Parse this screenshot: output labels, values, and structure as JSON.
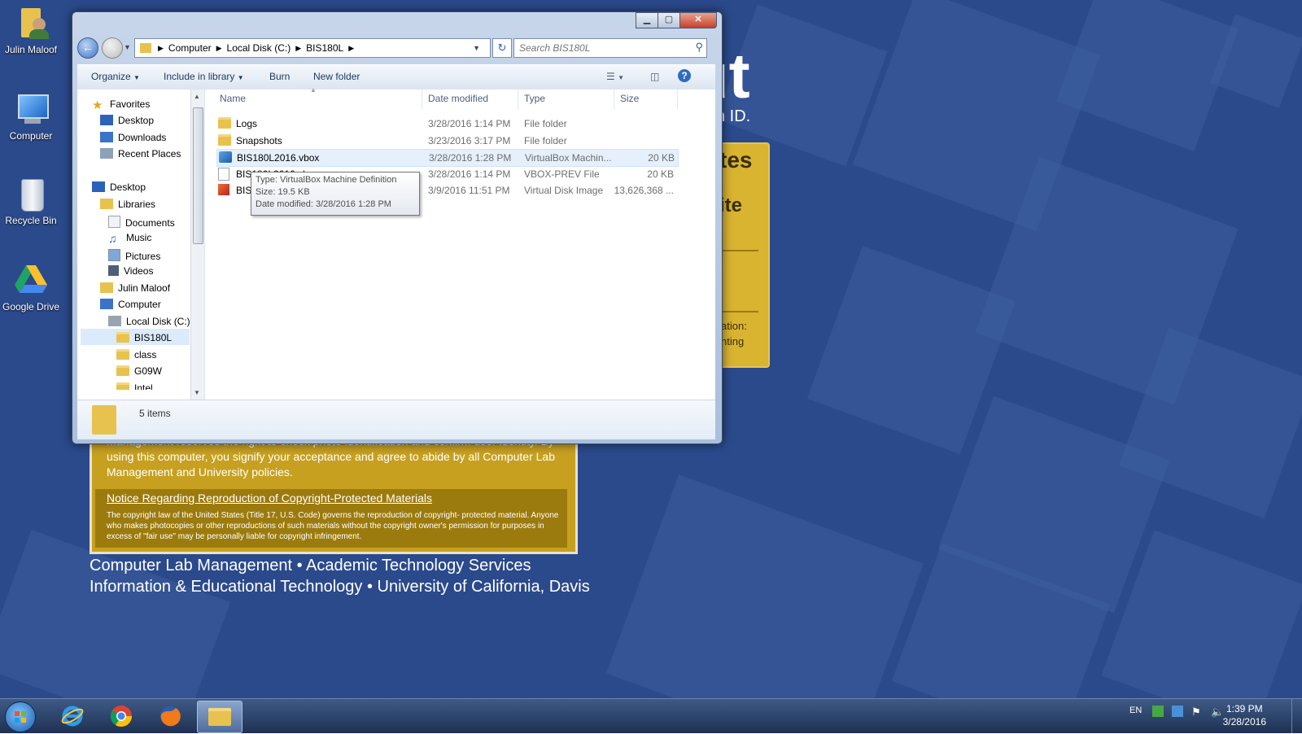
{
  "desktop": {
    "icons": [
      {
        "label": "Julin Maloof",
        "icon": "user-folder-icon"
      },
      {
        "label": "Computer",
        "icon": "computer-icon"
      },
      {
        "label": "Recycle Bin",
        "icon": "recycle-bin-icon"
      },
      {
        "label": "Google Drive",
        "icon": "google-drive-icon"
      }
    ],
    "wallpaper": {
      "banner_big": "ut",
      "banner_id": "n ID.",
      "gold_title_1": "tes",
      "gold_title_2": "ite",
      "gold_text_1": "ation:",
      "gold_text_2": "nting",
      "notice_text": "Management reserves the right to check photo identification and confirm user identity. By using this computer, you signify your acceptance and agree to abide by all Computer Lab Management and University policies.",
      "notice_heading": "Notice Regarding Reproduction of Copyright-Protected Materials",
      "notice_small": "The copyright law of the United States (Title 17, U.S. Code) governs the reproduction of copyright- protected material. Anyone who makes photocopies or other reproductions of such materials without the copyright owner's permission for purposes in excess of \"fair use\" may be personally liable for copyright infringement.",
      "footer_1": "Computer Lab Management • Academic Technology Services",
      "footer_2": "Information & Educational Technology • University of California, Davis"
    },
    "colors": {
      "background": "#2b4a8c",
      "gold": "#c7a020"
    }
  },
  "window": {
    "caption_buttons": {
      "minimize": "▁",
      "maximize": "▢",
      "close": "✕"
    },
    "breadcrumb": [
      "Computer",
      "Local Disk (C:)",
      "BIS180L"
    ],
    "search_placeholder": "Search BIS180L",
    "toolbar": {
      "organize": "Organize",
      "include_in_library": "Include in library",
      "burn": "Burn",
      "new_folder": "New folder"
    },
    "nav": {
      "favorites": "Favorites",
      "favorites_items": [
        "Desktop",
        "Downloads",
        "Recent Places"
      ],
      "desktop": "Desktop",
      "libraries": "Libraries",
      "library_items": [
        "Documents",
        "Music",
        "Pictures",
        "Videos"
      ],
      "user": "Julin Maloof",
      "computer": "Computer",
      "local_disk": "Local Disk (C:)",
      "disk_folders": [
        "BIS180L",
        "class",
        "G09W",
        "Intel"
      ]
    },
    "columns": {
      "name": "Name",
      "date": "Date modified",
      "type": "Type",
      "size": "Size"
    },
    "files": [
      {
        "name": "Logs",
        "date": "3/28/2016 1:14 PM",
        "type": "File folder",
        "size": "",
        "icon": "folder-icon"
      },
      {
        "name": "Snapshots",
        "date": "3/23/2016 3:17 PM",
        "type": "File folder",
        "size": "",
        "icon": "folder-icon"
      },
      {
        "name": "BIS180L2016.vbox",
        "date": "3/28/2016 1:28 PM",
        "type": "VirtualBox Machin...",
        "size": "20 KB",
        "icon": "vbox-icon"
      },
      {
        "name": "BIS180L2016.vbox-prev",
        "date": "3/28/2016 1:14 PM",
        "type": "VBOX-PREV File",
        "size": "20 KB",
        "icon": "blank-file-icon"
      },
      {
        "name": "BIS180L2016.vdi",
        "date": "3/9/2016 11:51 PM",
        "type": "Virtual Disk Image",
        "size": "13,626,368 ...",
        "icon": "vdi-icon"
      }
    ],
    "tooltip": {
      "type": "Type: VirtualBox Machine Definition",
      "size": "Size: 19.5 KB",
      "date": "Date modified: 3/28/2016 1:28 PM"
    },
    "status": {
      "item_count": "5 items"
    }
  },
  "taskbar": {
    "apps": [
      "internet-explorer-icon",
      "chrome-icon",
      "firefox-icon",
      "windows-explorer-icon"
    ],
    "language": "EN",
    "time": "1:39 PM",
    "date": "3/28/2016"
  }
}
